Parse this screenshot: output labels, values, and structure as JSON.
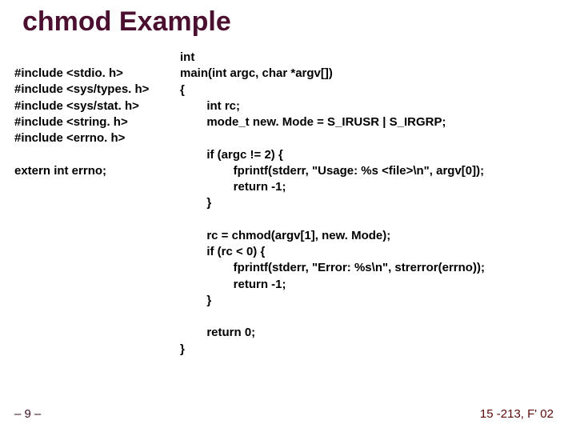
{
  "title": "chmod Example",
  "code_left": "#include <stdio. h>\n#include <sys/types. h>\n#include <sys/stat. h>\n#include <string. h>\n#include <errno. h>\n\nextern int errno;",
  "code_right": "int\nmain(int argc, char *argv[])\n{\n        int rc;\n        mode_t new. Mode = S_IRUSR | S_IRGRP;\n\n        if (argc != 2) {\n                fprintf(stderr, \"Usage: %s <file>\\n\", argv[0]);\n                return -1;\n        }\n\n        rc = chmod(argv[1], new. Mode);\n        if (rc < 0) {\n                fprintf(stderr, \"Error: %s\\n\", strerror(errno));\n                return -1;\n        }\n\n        return 0;\n}",
  "page_num": "– 9 –",
  "course": "15 -213, F' 02"
}
